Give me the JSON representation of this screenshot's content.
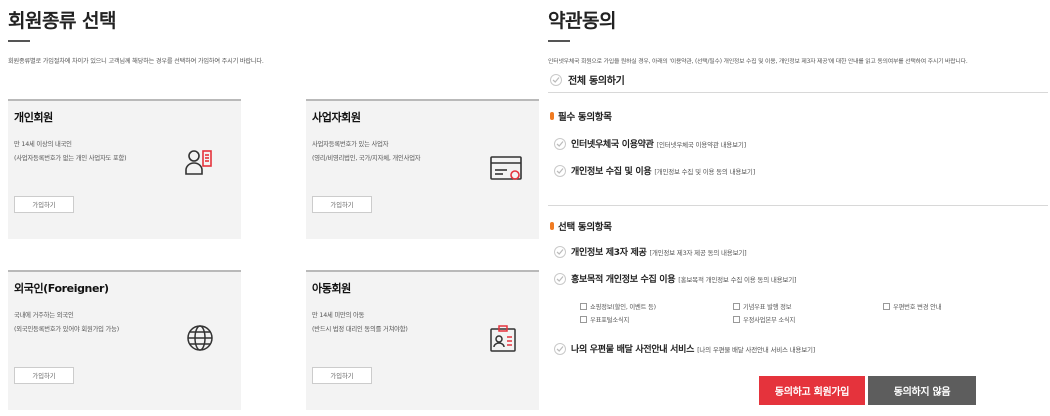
{
  "member_type": {
    "title": "회원종류 선택",
    "description": "회원종류별로 가입절차에 차이가 있으니 고객님께 해당하는 경우를 선택하여 가입하여 주시기 바랍니다.",
    "join_label": "가입하기",
    "cards": [
      {
        "title": "개인회원",
        "lines": [
          "만 14세 이상의 내국인",
          "(사업자등록번호가 없는 개인 사업자도 포함)"
        ],
        "icon": "id-person-icon"
      },
      {
        "title": "사업자회원",
        "lines": [
          "사업자등록번호가 있는 사업자",
          "(영리/비영리법인, 국가/지자체, 개인사업자"
        ],
        "icon": "business-card-icon"
      },
      {
        "title": "외국인(Foreigner)",
        "lines": [
          "국내에 거주하는 외국인",
          "(외국인등록번호가 있어야 회원가입 가능)"
        ],
        "icon": "globe-icon"
      },
      {
        "title": "아동회원",
        "lines": [
          "만 14세 미만의 아동",
          "(반드시 법정 대리인 동의를 거쳐야함)"
        ],
        "icon": "child-id-icon"
      }
    ]
  },
  "terms": {
    "title": "약관동의",
    "description": "인터넷우체국 회원으로 가입을 원하실 경우, 아래의 '이용약관, (선택/필수) 개인정보 수집 및 이용, 개인정보 제3자 제공'에 대한 안내를 읽고 동의여부를 선택하여 주시기 바랍니다.",
    "agree_all": "전체 동의하기",
    "required_head": "필수 동의항목",
    "required": [
      {
        "main": "인터넷우체국 이용약관",
        "sub": "[인터넷우체국 이용약관 내용보기]"
      },
      {
        "main": "개인정보 수집 및 이용",
        "sub": "[개인정보 수집 및 이용 동의 내용보기]"
      }
    ],
    "optional_head": "선택 동의항목",
    "optional": [
      {
        "main": "개인정보 제3자 제공",
        "sub": "[개인정보 제3자 제공 동의 내용보기]"
      },
      {
        "main": "홍보목적 개인정보 수집 이용",
        "sub": "[홍보목적 개인정보 수집 이용 동의 내용보기]"
      },
      {
        "main": "나의 우편물 배달 사전안내 서비스",
        "sub": "[나의 우편물 배달 사전안내 서비스 내용보기]"
      }
    ],
    "promo_options": [
      "쇼핑정보(할인, 이벤트 등)",
      "기념우표 발행 정보",
      "우편번호 변경 안내",
      "우표포털소식지",
      "우정사업본부 소식지"
    ],
    "agree_button": "동의하고 회원가입",
    "disagree_button": "동의하지 않음"
  },
  "colors": {
    "accent_red": "#e5333c",
    "dark_button": "#5d5d5d",
    "orange_dot": "#f07b22"
  }
}
